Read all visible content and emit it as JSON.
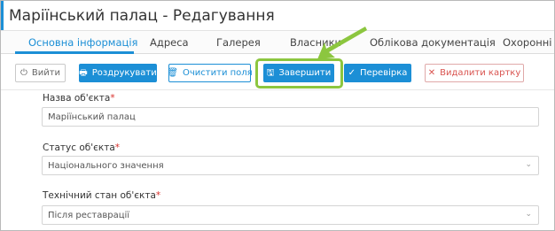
{
  "window": {
    "title": "Маріїнський палац - Редагування"
  },
  "tabs": [
    {
      "label": "Основна інформація",
      "active": true
    },
    {
      "label": "Адреса"
    },
    {
      "label": "Галерея"
    },
    {
      "label": "Власники"
    },
    {
      "label": "Облікова документація"
    },
    {
      "label": "Охоронні до"
    }
  ],
  "toolbar": {
    "exit_label": "Вийти",
    "print_label": "Роздрукувати",
    "clear_label": "Очистити поля",
    "finish_label": "Завершити",
    "check_label": "Перевірка",
    "delete_label": "Видалити картку"
  },
  "form": {
    "name": {
      "label": "Назва об'єкта",
      "required_mark": "*",
      "value": "Маріїнський палац"
    },
    "status": {
      "label": "Статус об'єкта",
      "required_mark": "*",
      "value": "Національного значення"
    },
    "condition": {
      "label": "Технічний стан об'єкта",
      "required_mark": "*",
      "value": "Після реставрації"
    }
  },
  "colors": {
    "accent": "#1c8fd6",
    "highlight": "#8cc63f",
    "danger": "#d9534f"
  },
  "icons": {
    "exit": "power-icon",
    "print": "printer-icon",
    "clear": "trash-icon",
    "finish": "save-icon",
    "check": "check-icon",
    "delete": "close-icon",
    "select": "chevron-down-icon"
  }
}
